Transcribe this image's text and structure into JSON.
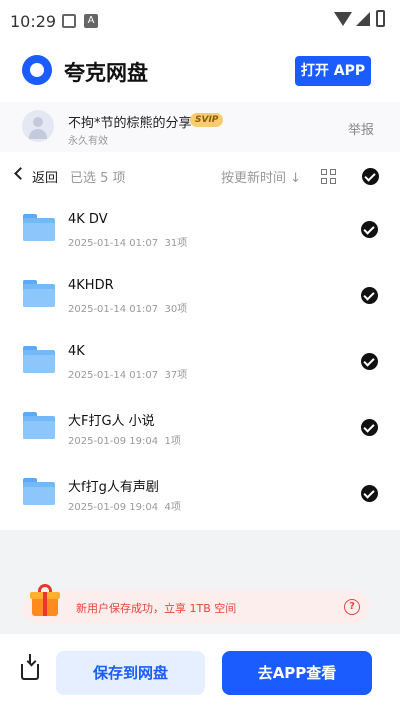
{
  "status_bar": {
    "time": "10:29",
    "notif_a": "A"
  },
  "header": {
    "app_name": "夸克网盘",
    "open_app_label": "打开 APP"
  },
  "sharer": {
    "name": "不拘*节的棕熊的分享",
    "badge": "SVIP",
    "validity": "永久有效",
    "report_label": "举报"
  },
  "toolbar": {
    "back_label": "返回",
    "selected_text": "已选 5 项",
    "sort_label": "按更新时间 ↓"
  },
  "files": [
    {
      "name": "4K DV",
      "date": "2025-01-14 01:07",
      "count": "31项"
    },
    {
      "name": "4KHDR",
      "date": "2025-01-14 01:07",
      "count": "30项"
    },
    {
      "name": "4K",
      "date": "2025-01-14 01:07",
      "count": "37项"
    },
    {
      "name": "大F打G人 小说",
      "date": "2025-01-09 19:04",
      "count": "1项"
    },
    {
      "name": "大f打g人有声剧",
      "date": "2025-01-09 19:04",
      "count": "4项"
    }
  ],
  "promo": {
    "text": "新用户保存成功，立享 1TB 空间",
    "help": "?"
  },
  "bottom": {
    "save_label": "保存到网盘",
    "go_label": "去APP查看"
  },
  "colors": {
    "accent": "#1a5cff",
    "promo_text": "#e8443a",
    "folder": "#74b9f7"
  }
}
